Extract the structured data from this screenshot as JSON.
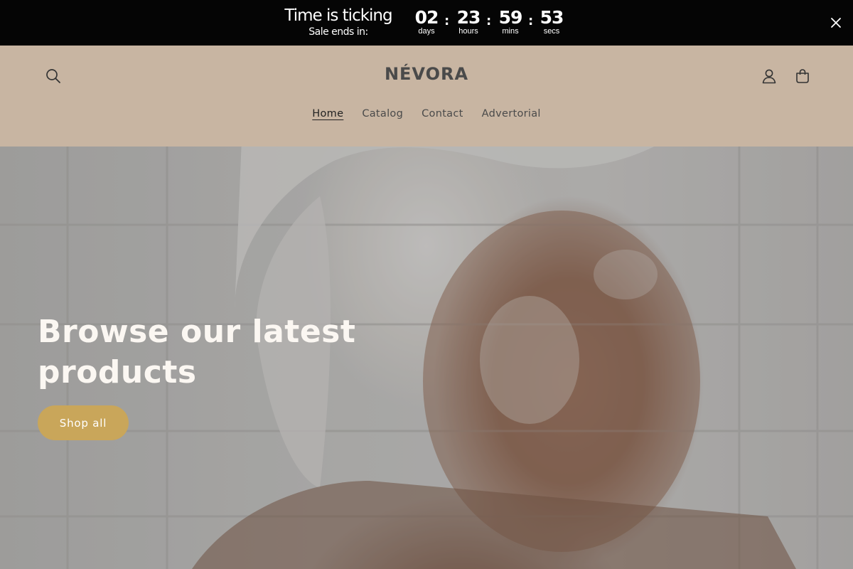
{
  "countdown": {
    "title": "Time is ticking",
    "subtitle": "Sale ends in:",
    "units": [
      {
        "value": "02",
        "label": "days"
      },
      {
        "value": "23",
        "label": "hours"
      },
      {
        "value": "59",
        "label": "mins"
      },
      {
        "value": "53",
        "label": "secs"
      }
    ],
    "separator": ":"
  },
  "header": {
    "logo": "NÉVORA",
    "nav": [
      {
        "label": "Home",
        "active": true
      },
      {
        "label": "Catalog",
        "active": false
      },
      {
        "label": "Contact",
        "active": false
      },
      {
        "label": "Advertorial",
        "active": false
      }
    ],
    "icons": [
      "search-icon",
      "account-icon",
      "cart-icon"
    ]
  },
  "hero": {
    "title": "Browse our latest products",
    "button_label": "Shop all"
  },
  "colors": {
    "countdown_bg": "#050505",
    "header_bg": "#c8b5a2",
    "button_bg": "#c9a65a",
    "hero_text": "#fbf7f2"
  }
}
